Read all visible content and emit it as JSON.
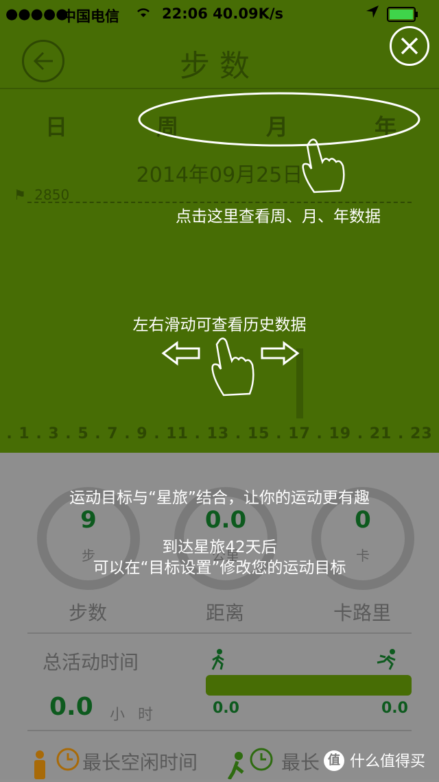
{
  "status_bar": {
    "signal": "●●●●●",
    "carrier": "中国电信",
    "wifi": "wifi-icon",
    "time_speed": "22:06 40.09K/s",
    "battery_color": "#3fd44a"
  },
  "nav": {
    "title": "步数"
  },
  "period_tabs": [
    "日",
    "周",
    "月",
    "年"
  ],
  "date": "2014年09月25日",
  "goal_value": "2850",
  "x_axis": ". 1 . 3 . 5 . 7 . 9 . 11 . 13 . 15 . 17 . 19 . 21 . 23",
  "rings": [
    {
      "value": "9",
      "unit": "步"
    },
    {
      "value": "0.0",
      "unit": "公里"
    },
    {
      "value": "0",
      "unit": "卡"
    }
  ],
  "metrics": [
    "步数",
    "距离",
    "卡路里"
  ],
  "total_activity": {
    "label": "总活动时间",
    "value": "0.0",
    "unit": "小 时",
    "walk_value": "0.0",
    "run_value": "0.0"
  },
  "bottom": {
    "idle_label": "最长空闲时间",
    "active_label": "最长"
  },
  "overlay": {
    "tab_hint": "点击这里查看周、月、年数据",
    "swipe_hint": "左右滑动可查看历史数据",
    "goal_line1": "运动目标与“星旅”结合，让你的运动更有趣",
    "goal_line2": "到达星旅42天后",
    "goal_line3": "可以在“目标设置”修改您的运动目标"
  },
  "watermark": "什么值得买",
  "colors": {
    "top_bg": "#476d05",
    "accent": "#0d5a1e"
  }
}
